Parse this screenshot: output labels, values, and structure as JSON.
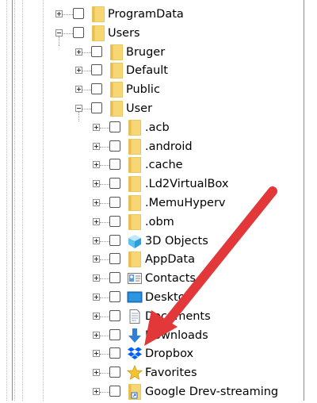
{
  "tree": {
    "items": [
      {
        "label": "ProgramData",
        "level": 0,
        "expanded": false,
        "icon": "folder-icon"
      },
      {
        "label": "Users",
        "level": 0,
        "expanded": true,
        "icon": "folder-icon"
      },
      {
        "label": "Bruger",
        "level": 1,
        "expanded": false,
        "icon": "folder-icon"
      },
      {
        "label": "Default",
        "level": 1,
        "expanded": false,
        "icon": "folder-icon"
      },
      {
        "label": "Public",
        "level": 1,
        "expanded": false,
        "icon": "folder-icon"
      },
      {
        "label": "User",
        "level": 1,
        "expanded": true,
        "icon": "folder-icon"
      },
      {
        "label": ".acb",
        "level": 2,
        "expanded": false,
        "icon": "folder-icon"
      },
      {
        "label": ".android",
        "level": 2,
        "expanded": false,
        "icon": "folder-icon"
      },
      {
        "label": ".cache",
        "level": 2,
        "expanded": false,
        "icon": "folder-icon"
      },
      {
        "label": ".Ld2VirtualBox",
        "level": 2,
        "expanded": false,
        "icon": "folder-icon"
      },
      {
        "label": ".MemuHyperv",
        "level": 2,
        "expanded": false,
        "icon": "folder-icon"
      },
      {
        "label": ".obm",
        "level": 2,
        "expanded": false,
        "icon": "folder-icon"
      },
      {
        "label": "3D Objects",
        "level": 2,
        "expanded": false,
        "icon": "3d-objects-icon"
      },
      {
        "label": "AppData",
        "level": 2,
        "expanded": false,
        "icon": "folder-icon"
      },
      {
        "label": "Contacts",
        "level": 2,
        "expanded": false,
        "icon": "contacts-icon"
      },
      {
        "label": "Desktop",
        "level": 2,
        "expanded": false,
        "icon": "desktop-icon"
      },
      {
        "label": "Documents",
        "level": 2,
        "expanded": false,
        "icon": "documents-icon"
      },
      {
        "label": "Downloads",
        "level": 2,
        "expanded": false,
        "icon": "downloads-icon"
      },
      {
        "label": "Dropbox",
        "level": 2,
        "expanded": false,
        "icon": "dropbox-icon"
      },
      {
        "label": "Favorites",
        "level": 2,
        "expanded": false,
        "icon": "favorites-icon"
      },
      {
        "label": "Google Drev-streaming",
        "level": 2,
        "expanded": false,
        "icon": "google-drive-shortcut-icon"
      }
    ]
  },
  "annotation": {
    "icon": "red-arrow-icon",
    "color": "#e2383a",
    "points_to": "Dropbox"
  },
  "colors": {
    "folder": "#f7d774",
    "folder_tab": "#e9bd4c",
    "dropbox": "#0061fe",
    "downloads": "#2f7fd6",
    "star": "#f3c431",
    "arrow": "#e2383a"
  }
}
